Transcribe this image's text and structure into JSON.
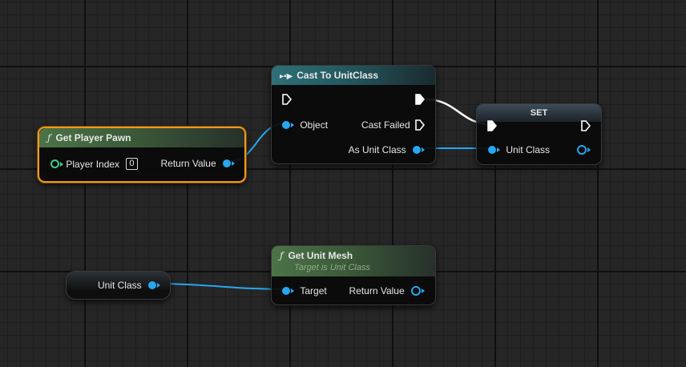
{
  "colors": {
    "object_pin": "#27a7f0",
    "int_pin": "#3fcc8a",
    "exec_pin": "#ffffff",
    "selection": "#f19a1a",
    "function_header": "#4c7348",
    "cast_header": "#2f7078"
  },
  "nodes": {
    "get_player_pawn": {
      "icon": "function-icon",
      "title": "Get Player Pawn",
      "player_index_label": "Player Index",
      "player_index_value": "0",
      "return_value_label": "Return Value"
    },
    "cast": {
      "icon": "cast-icon",
      "title": "Cast To UnitClass",
      "object_label": "Object",
      "cast_failed_label": "Cast Failed",
      "as_unit_class_label": "As Unit Class"
    },
    "set": {
      "title": "SET",
      "unit_class_label": "Unit Class"
    },
    "unit_class_var": {
      "label": "Unit Class"
    },
    "get_unit_mesh": {
      "icon": "function-icon",
      "title": "Get Unit Mesh",
      "subtitle": "Target is Unit Class",
      "target_label": "Target",
      "return_value_label": "Return Value"
    }
  }
}
